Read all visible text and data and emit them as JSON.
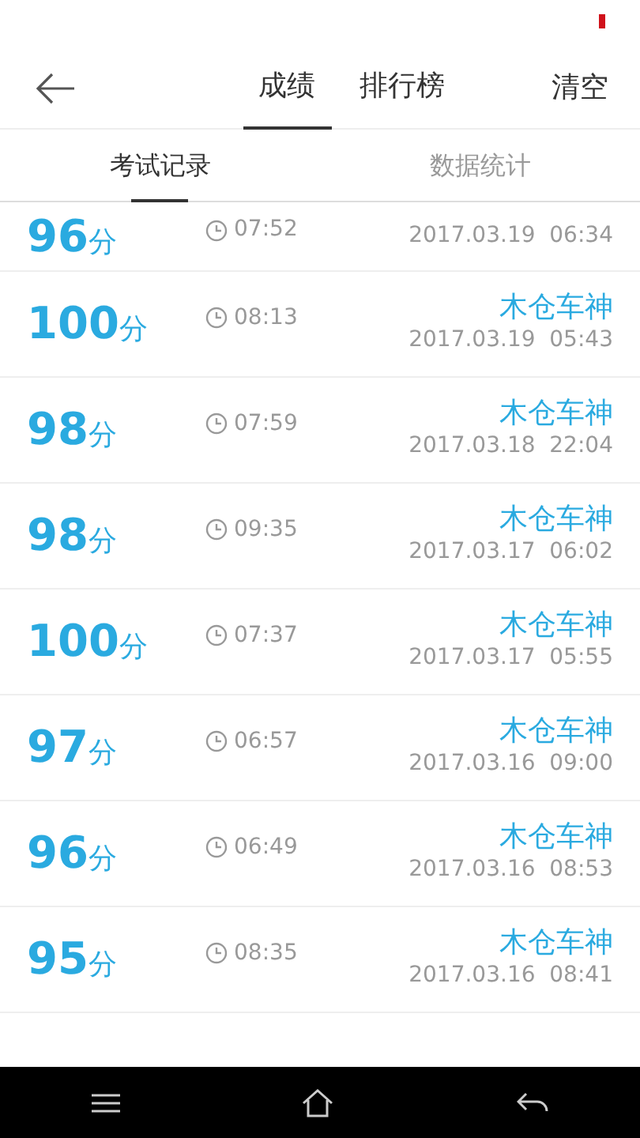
{
  "header": {
    "tabs": [
      {
        "label": "成绩",
        "selected": true
      },
      {
        "label": "排行榜",
        "selected": false
      }
    ],
    "action": "清空"
  },
  "subtabs": [
    {
      "label": "考试记录",
      "selected": true
    },
    {
      "label": "数据统计",
      "selected": false
    }
  ],
  "records": [
    {
      "score": "96",
      "unit": "分",
      "duration": "07:52",
      "date": "2017.03.19  06:34"
    },
    {
      "score": "100",
      "unit": "分",
      "duration": "08:13",
      "name": "木仓车神",
      "date": "2017.03.19  05:43"
    },
    {
      "score": "98",
      "unit": "分",
      "duration": "07:59",
      "name": "木仓车神",
      "date": "2017.03.18  22:04"
    },
    {
      "score": "98",
      "unit": "分",
      "duration": "09:35",
      "name": "木仓车神",
      "date": "2017.03.17  06:02"
    },
    {
      "score": "100",
      "unit": "分",
      "duration": "07:37",
      "name": "木仓车神",
      "date": "2017.03.17  05:55"
    },
    {
      "score": "97",
      "unit": "分",
      "duration": "06:57",
      "name": "木仓车神",
      "date": "2017.03.16  09:00"
    },
    {
      "score": "96",
      "unit": "分",
      "duration": "06:49",
      "name": "木仓车神",
      "date": "2017.03.16  08:53"
    },
    {
      "score": "95",
      "unit": "分",
      "duration": "08:35",
      "name": "木仓车神",
      "date": "2017.03.16  08:41"
    }
  ]
}
